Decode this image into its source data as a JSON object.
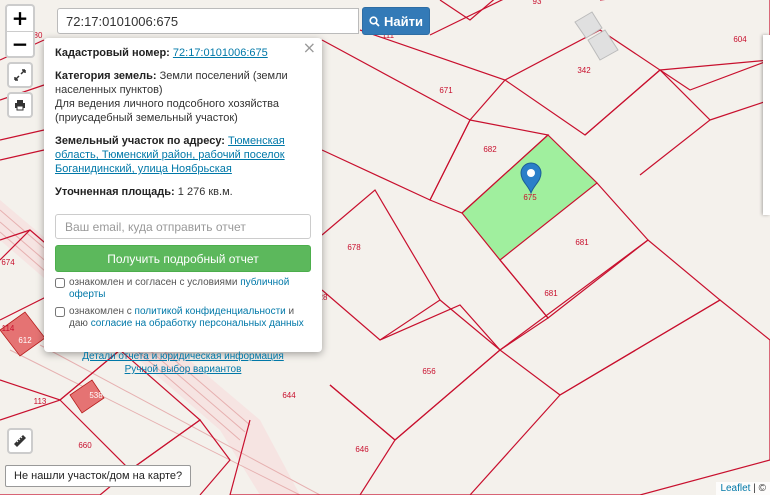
{
  "search": {
    "value": "72:17:0101006:675",
    "button_label": "Найти"
  },
  "zoom": {
    "in_label": "+",
    "out_label": "−"
  },
  "icons": {
    "fullscreen": "fullscreen-icon",
    "print": "printer-icon",
    "ruler": "ruler-icon",
    "search": "search-icon",
    "close": "close-icon",
    "marker": "map-marker-icon"
  },
  "colors": {
    "accent_blue": "#337ab7",
    "green_button": "#5cb85c",
    "parcel_border": "#c8102e",
    "selected_parcel": "#90ee90",
    "building_red": "#e57373"
  },
  "popup": {
    "cadastral_label": "Кадастровый номер:",
    "cadastral_value": "72:17:0101006:675",
    "category_label": "Категория земель:",
    "category_value": "Земли поселений (земли населенных пунктов)",
    "usage": "Для ведения личного подсобного хозяйства (приусадебный земельный участок)",
    "address_label": "Земельный участок по адресу:",
    "address_value": "Тюменская область, Тюменский район, рабочий поселок Боганидинский, улица Ноябрьская",
    "area_label": "Уточненная площадь:",
    "area_value": "1 276 кв.м.",
    "email_placeholder": "Ваш email, куда отправить отчет",
    "report_button": "Получить подробный отчет",
    "agree1_text": "ознакомлен и согласен с условиями ",
    "agree1_link": "публичной оферты",
    "agree2_text": "ознакомлен с ",
    "agree2_link1": "политикой конфиденциальности",
    "agree2_mid": " и даю ",
    "agree2_link2": "согласие на обработку персональных данных",
    "details_link": "Детали отчета и юридическая информация",
    "manual_link": "Ручной выбор вариантов",
    "close_symbol": "×"
  },
  "map_labels": [
    "80",
    "111",
    "93",
    "604",
    "342",
    "671",
    "682",
    "675",
    "681",
    "681",
    "678",
    "674",
    "114",
    "612",
    "113",
    "538",
    "656",
    "644",
    "646",
    "660",
    "28"
  ],
  "bottom_button": "Не нашли участок/дом на карте?",
  "attribution": {
    "link": "Leaflet",
    "rest": " | ©"
  }
}
